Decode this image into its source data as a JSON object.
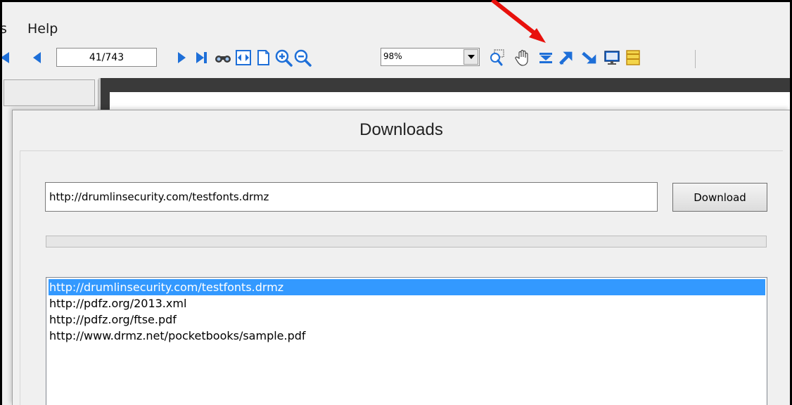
{
  "menu": {
    "items": [
      "s",
      "Help"
    ]
  },
  "toolbar": {
    "page_field": "41/743",
    "zoom": "98%",
    "icons": [
      "first-page-icon",
      "prev-page-icon",
      "next-page-icon",
      "last-page-icon",
      "find-icon",
      "fit-width-icon",
      "fit-page-icon",
      "zoom-in-icon",
      "zoom-out-icon",
      "zoom-rect-icon",
      "hand-icon",
      "download-icon",
      "rotate-ccw-icon",
      "rotate-cw-icon",
      "screen-icon",
      "notes-icon"
    ]
  },
  "dialog": {
    "title": "Downloads",
    "url_value": "http://drumlinsecurity.com/testfonts.drmz",
    "download_label": "Download",
    "progress": 0,
    "history": [
      {
        "text": "http://drumlinsecurity.com/testfonts.drmz",
        "selected": true
      },
      {
        "text": "http://pdfz.org/2013.xml",
        "selected": false
      },
      {
        "text": "http://pdfz.org/ftse.pdf",
        "selected": false
      },
      {
        "text": "http://www.drmz.net/pocketbooks/sample.pdf",
        "selected": false
      }
    ]
  },
  "colors": {
    "annotation_arrow": "#e8110c",
    "selection": "#3399ff",
    "toolbar_icon_blue": "#1e6fd8"
  }
}
